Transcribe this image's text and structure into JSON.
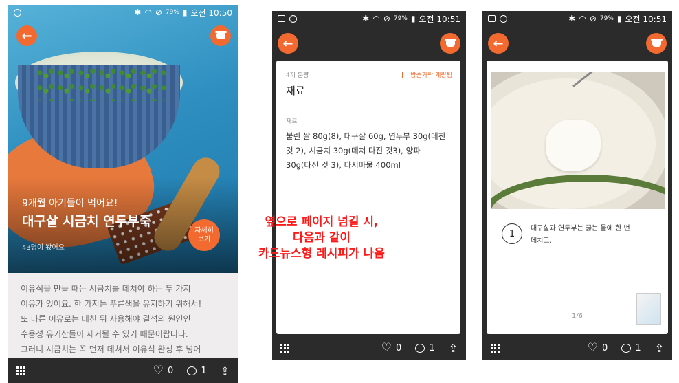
{
  "status_bar": {
    "battery": "79%",
    "phone1_time": "오전 10:50",
    "phone2_time": "오전 10:51",
    "phone3_time": "오전 10:51"
  },
  "phone1": {
    "subtitle": "9개월 아기들이 먹어요!",
    "title": "대구살 시금치 연두부죽",
    "views": "43명이 봤어요",
    "detail_button": [
      "자세히",
      "보기"
    ],
    "description": [
      "이유식을 만들 때는 시금치를 데쳐야 하는 두 가지",
      "이유가 있어요. 한 가지는 푸른색을 유지하기 위해서!",
      "또 다른 이유로는 데친 뒤 사용해야 결석의 원인인",
      "수용성 유기산들이 제거될 수 있기 때문이랍니다.",
      "그러니 시금치는 꼭 먼저 데쳐서 이유식 완성 후 넣어"
    ],
    "likes": "0",
    "comments": "1"
  },
  "phone2": {
    "serving": "4끼 분량",
    "tip_link": "밥숟가락 계량팁",
    "heading": "재료",
    "label": "재료",
    "ingredients": [
      "불린 쌀 80g(8), 대구살 60g, 연두부 30g(데친",
      "것 2), 시금치 30g(데쳐 다진 것3), 양파",
      "30g(다진 것 3), 다시마물 400ml"
    ],
    "likes": "0",
    "comments": "1"
  },
  "phone3": {
    "step_number": "1",
    "step_text": [
      "대구살과 연두부는 끓는 물에 한 번",
      "데치고,"
    ],
    "pager": "1/6",
    "likes": "0",
    "comments": "1"
  },
  "annotation": {
    "lines": [
      "옆으로 페이지 넘길 시,",
      "다음과 같이",
      "카드뉴스형 레시피가 나옴"
    ],
    "color": "#ff1a1a"
  },
  "colors": {
    "accent": "#f26a2f",
    "bar": "#2b2b2b"
  },
  "icons": [
    "back-arrow-icon",
    "pot-icon",
    "menu-grid-icon",
    "heart-icon",
    "comment-icon",
    "share-icon"
  ]
}
